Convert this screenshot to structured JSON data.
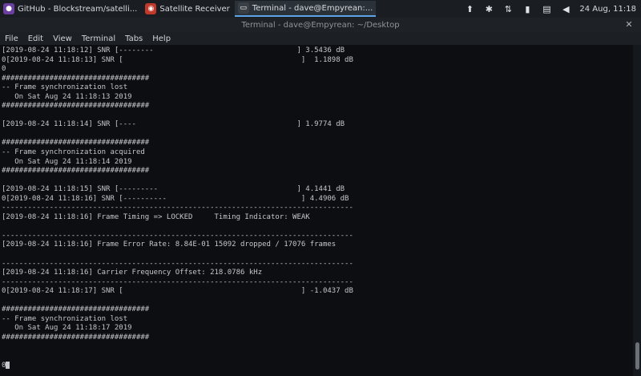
{
  "taskbar": {
    "tasks": [
      {
        "label": "GitHub - Blockstream/satelli...",
        "icon": "firefox-icon",
        "color": "#6a3fa0"
      },
      {
        "label": "Satellite Receiver",
        "icon": "chrome-icon",
        "color": "#c0392b"
      },
      {
        "label": "Terminal - dave@Empyrean:...",
        "icon": "terminal-icon",
        "color": "#3a3f46"
      }
    ],
    "clock": "24 Aug, 11:18"
  },
  "window": {
    "title": "Terminal - dave@Empyrean: ~/Desktop"
  },
  "menu": [
    "File",
    "Edit",
    "View",
    "Terminal",
    "Tabs",
    "Help"
  ],
  "terminal": {
    "lines": [
      "[2019-08-24 11:18:12] SNR [--------                                 ] 3.5436 dB",
      "0[2019-08-24 11:18:13] SNR [                                         ]  1.1898 dB",
      "0",
      "##################################",
      "-- Frame synchronization lost",
      "   On Sat Aug 24 11:18:13 2019",
      "##################################",
      "",
      "[2019-08-24 11:18:14] SNR [----                                     ] 1.9774 dB",
      "",
      "##################################",
      "-- Frame synchronization acquired",
      "   On Sat Aug 24 11:18:14 2019",
      "##################################",
      "",
      "[2019-08-24 11:18:15] SNR [---------                                ] 4.1441 dB",
      "0[2019-08-24 11:18:16] SNR [----------                               ] 4.4906 dB",
      "---------------------------------------------------------------------------------",
      "[2019-08-24 11:18:16] Frame Timing => LOCKED     Timing Indicator: WEAK",
      "",
      "---------------------------------------------------------------------------------",
      "[2019-08-24 11:18:16] Frame Error Rate: 8.84E-01 15092 dropped / 17076 frames",
      "",
      "---------------------------------------------------------------------------------",
      "[2019-08-24 11:18:16] Carrier Frequency Offset: 218.0786 kHz",
      "---------------------------------------------------------------------------------",
      "0[2019-08-24 11:18:17] SNR [                                         ] -1.0437 dB",
      "",
      "##################################",
      "-- Frame synchronization lost",
      "   On Sat Aug 24 11:18:17 2019",
      "##################################",
      "",
      "",
      "0"
    ]
  }
}
